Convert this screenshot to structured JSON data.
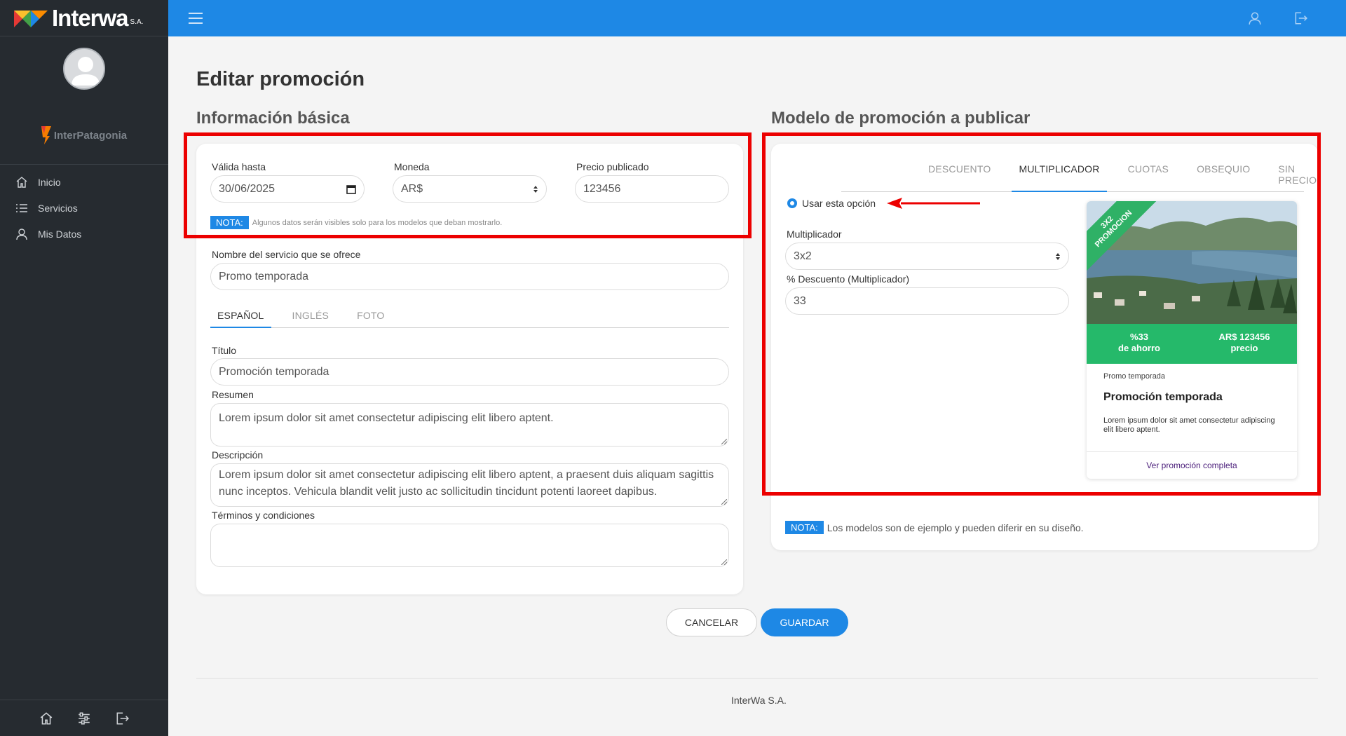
{
  "brand": {
    "name": "Interwa",
    "suffix": "S.A.",
    "org": "InterPatagonia"
  },
  "sidebar": {
    "items": [
      {
        "label": "Inicio",
        "icon": "home-icon"
      },
      {
        "label": "Servicios",
        "icon": "list-icon"
      },
      {
        "label": "Mis Datos",
        "icon": "user-icon"
      }
    ]
  },
  "page": {
    "title": "Editar promoción",
    "basic_title": "Información básica",
    "model_title": "Modelo de promoción a publicar"
  },
  "basic": {
    "valid_until_label": "Válida hasta",
    "valid_until_value": "30/06/2025",
    "currency_label": "Moneda",
    "currency_value": "AR$",
    "price_label": "Precio publicado",
    "price_value": "123456",
    "nota_label": "NOTA:",
    "nota_text": "Algunos datos serán visibles solo para los modelos que deban mostrarlo.",
    "service_label": "Nombre del servicio que se ofrece",
    "service_value": "Promo temporada",
    "tabs": [
      "ESPAÑOL",
      "INGLÉS",
      "FOTO"
    ],
    "titulo_label": "Título",
    "titulo_value": "Promoción temporada",
    "resumen_label": "Resumen",
    "resumen_value": "Lorem ipsum dolor sit amet consectetur adipiscing elit libero aptent.",
    "descripcion_label": "Descripción",
    "descripcion_value": "Lorem ipsum dolor sit amet consectetur adipiscing elit libero aptent, a praesent duis aliquam sagittis nunc inceptos. Vehicula blandit velit justo ac sollicitudin tincidunt potenti laoreet dapibus.",
    "terminos_label": "Términos y condiciones",
    "terminos_value": ""
  },
  "model": {
    "tabs": [
      "DESCUENTO",
      "MULTIPLICADOR",
      "CUOTAS",
      "OBSEQUIO",
      "SIN PRECIO"
    ],
    "use_option_label": "Usar esta opción",
    "multiplier_label": "Multiplicador",
    "multiplier_value": "3x2",
    "discount_label": "% Descuento (Multiplicador)",
    "discount_value": "33",
    "nota_label": "NOTA:",
    "nota_text": "Los modelos son de ejemplo y pueden diferir en su diseño."
  },
  "preview": {
    "ribbon_line1": "3X2",
    "ribbon_line2": "PROMOCION",
    "savings_value": "%33",
    "savings_label": "de ahorro",
    "price_value": "AR$ 123456",
    "price_label": "precio",
    "service": "Promo temporada",
    "title": "Promoción temporada",
    "summary": "Lorem ipsum dolor sit amet consectetur adipiscing elit libero aptent.",
    "link": "Ver promoción completa"
  },
  "actions": {
    "cancel": "CANCELAR",
    "save": "GUARDAR"
  },
  "footer": {
    "text": "InterWa S.A."
  },
  "colors": {
    "primary": "#1e88e5",
    "sidebar": "#262b30",
    "highlight": "#ec0000",
    "promo_green": "#25b96a"
  }
}
